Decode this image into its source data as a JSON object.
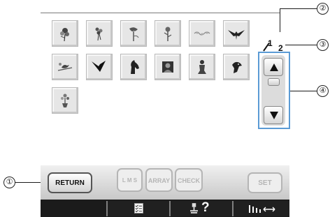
{
  "page": {
    "current": "1",
    "total": "2"
  },
  "buttons": {
    "return": "RETURN",
    "lms": "L M S",
    "array": "ARRAY",
    "check": "CHECK",
    "set": "SET"
  },
  "bottom_bar": {
    "help_mark": "?",
    "icons": [
      "checklist-icon",
      "machine-help-icon",
      "thread-spacing-icon"
    ]
  },
  "callouts": [
    "①",
    "②",
    "③",
    "④"
  ],
  "pattern_tiles": [
    "rose",
    "bouquet",
    "orchid",
    "flower-stem",
    "floral-border",
    "eagle",
    "bird-on-branch",
    "flying-eagle",
    "horse-head",
    "portrait-square",
    "figure",
    "parrot",
    "flower-pot"
  ],
  "colors": {
    "accent_blue": "#5b9bd5",
    "tile_bg": "#e6e6e6",
    "bar_dark": "#1b1b1b"
  }
}
